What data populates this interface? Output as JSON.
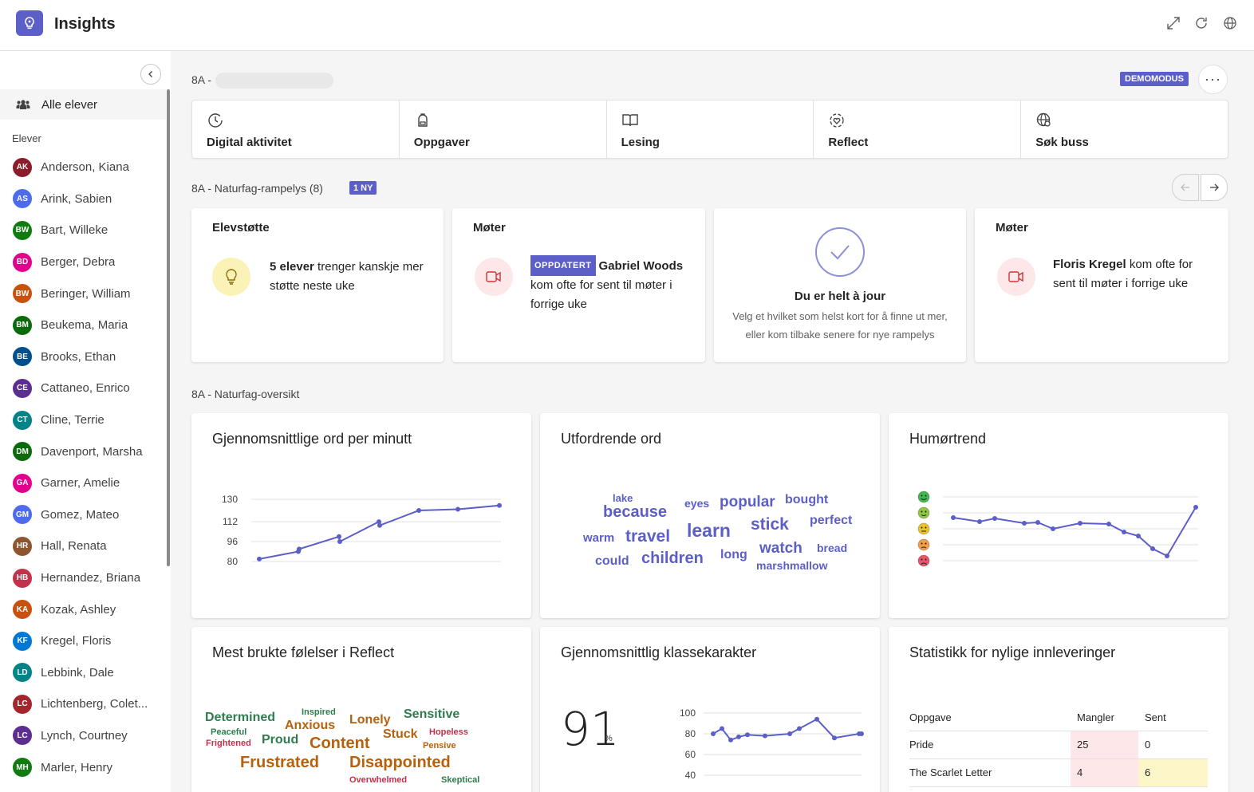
{
  "app": {
    "title": "Insights"
  },
  "sidebar": {
    "all_label": "Alle elever",
    "section_label": "Elever",
    "students": [
      {
        "initials": "AK",
        "name": "Anderson, Kiana",
        "color": "#8b1c2c"
      },
      {
        "initials": "AS",
        "name": "Arink, Sabien",
        "color": "#4f6bed"
      },
      {
        "initials": "BW",
        "name": "Bart, Willeke",
        "color": "#107c10"
      },
      {
        "initials": "BD",
        "name": "Berger, Debra",
        "color": "#e3008c"
      },
      {
        "initials": "BW",
        "name": "Beringer, William",
        "color": "#ca5010"
      },
      {
        "initials": "BM",
        "name": "Beukema, Maria",
        "color": "#0b6a0b"
      },
      {
        "initials": "BE",
        "name": "Brooks, Ethan",
        "color": "#004e8c"
      },
      {
        "initials": "CE",
        "name": "Cattaneo, Enrico",
        "color": "#5c2e91"
      },
      {
        "initials": "CT",
        "name": "Cline, Terrie",
        "color": "#038387"
      },
      {
        "initials": "DM",
        "name": "Davenport, Marsha",
        "color": "#0b6a0b"
      },
      {
        "initials": "GA",
        "name": "Garner, Amelie",
        "color": "#e3008c"
      },
      {
        "initials": "GM",
        "name": "Gomez, Mateo",
        "color": "#4f6bed"
      },
      {
        "initials": "HR",
        "name": "Hall, Renata",
        "color": "#8e562e"
      },
      {
        "initials": "HB",
        "name": "Hernandez, Briana",
        "color": "#c4314b"
      },
      {
        "initials": "KA",
        "name": "Kozak, Ashley",
        "color": "#ca5010"
      },
      {
        "initials": "KF",
        "name": "Kregel, Floris",
        "color": "#0078d4"
      },
      {
        "initials": "LD",
        "name": "Lebbink, Dale",
        "color": "#038387"
      },
      {
        "initials": "LC",
        "name": "Lichtenberg, Colet...",
        "color": "#a4262c"
      },
      {
        "initials": "LC",
        "name": "Lynch, Courtney",
        "color": "#5c2e91"
      },
      {
        "initials": "MH",
        "name": "Marler, Henry",
        "color": "#107c10"
      }
    ]
  },
  "header": {
    "class_name": "8A -",
    "demo_badge": "DEMOMODUS",
    "more_label": "···"
  },
  "tabs": [
    {
      "label": "Digital aktivitet",
      "icon": "clock-icon"
    },
    {
      "label": "Oppgaver",
      "icon": "backpack-icon"
    },
    {
      "label": "Lesing",
      "icon": "book-icon"
    },
    {
      "label": "Reflect",
      "icon": "reflect-icon"
    },
    {
      "label": "Søk buss",
      "icon": "globe-search-icon"
    }
  ],
  "spotlight": {
    "title": "8A - Naturfag-rampelys (8)",
    "new_badge": "1 NY",
    "cards": {
      "support": {
        "title": "Elevstøtte",
        "bold": "5 elever",
        "text": " trenger kanskje mer støtte neste uke"
      },
      "meet1": {
        "title": "Møter",
        "badge": "OPPDATERT",
        "bold": "Gabriel Woods",
        "text": " kom ofte for sent til møter i forrige uke"
      },
      "uptodate": {
        "title": "Du er helt à jour",
        "text": "Velg et hvilket som helst kort for å finne ut mer, eller kom tilbake senere for nye rampelys"
      },
      "meet2": {
        "title": "Møter",
        "bold": "Floris Kregel",
        "text": " kom ofte for sent til møter i forrige uke"
      }
    }
  },
  "overview": {
    "title": "8A - Naturfag-oversikt",
    "wpm": {
      "title": "Gjennomsnittlige ord per minutt"
    },
    "words": {
      "title": "Utfordrende ord",
      "items": [
        "lake",
        "because",
        "eyes",
        "popular",
        "bought",
        "warm",
        "travel",
        "learn",
        "stick",
        "perfect",
        "could",
        "children",
        "long",
        "watch",
        "bread",
        "marshmallow"
      ]
    },
    "mood": {
      "title": "Humørtrend"
    },
    "feelings": {
      "title": "Mest brukte følelser i Reflect",
      "items": [
        "Determined",
        "Inspired",
        "Lonely",
        "Sensitive",
        "Peaceful",
        "Anxious",
        "Hopeless",
        "Frightened",
        "Proud",
        "Content",
        "Stuck",
        "Pensive",
        "Frustrated",
        "Disappointed",
        "Overwhelmed",
        "Skeptical"
      ]
    },
    "grade": {
      "title": "Gjennomsnittlig klassekarakter",
      "value": "91",
      "unit": "%"
    },
    "stats": {
      "title": "Statistikk for nylige innleveringer",
      "headers": [
        "Oppgave",
        "Mangler",
        "Sent"
      ],
      "rows": [
        [
          "Pride",
          "25",
          "0"
        ],
        [
          "The Scarlet Letter",
          "4",
          "6"
        ]
      ]
    }
  },
  "chart_data": [
    {
      "type": "line",
      "title": "Gjennomsnittlige ord per minutt",
      "y_ticks": [
        80,
        96,
        112,
        130
      ],
      "ylim": [
        80,
        130
      ],
      "values": [
        82,
        88,
        90,
        100,
        96,
        112,
        109,
        121,
        122,
        125
      ]
    },
    {
      "type": "line",
      "title": "Humørtrend",
      "y_levels": 5,
      "values": [
        3.7,
        3.45,
        3.65,
        3.35,
        3.4,
        3.0,
        3.35,
        3.3,
        2.8,
        2.55,
        1.75,
        1.3,
        4.35
      ]
    },
    {
      "type": "line",
      "title": "Gjennomsnittlig klassekarakter",
      "y_ticks": [
        40,
        60,
        80,
        100
      ],
      "ylim": [
        40,
        100
      ],
      "values": [
        80,
        85,
        74,
        77,
        79,
        78,
        80,
        85,
        94,
        76,
        80,
        80
      ]
    }
  ]
}
